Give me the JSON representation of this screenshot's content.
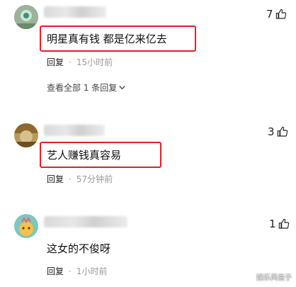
{
  "comments": [
    {
      "likes": "7",
      "text": "明星真有钱 都是亿来亿去",
      "reply_label": "回复",
      "time": "15小时前",
      "expand_label": "查看全部 1 条回复"
    },
    {
      "likes": "3",
      "text": "艺人赚钱真容易",
      "reply_label": "回复",
      "time": "57分钟前"
    },
    {
      "likes": "1",
      "text": "这女的不俊呀",
      "reply_label": "回复",
      "time": "1小时前"
    }
  ],
  "watermark": "娱乐风信子",
  "colors": {
    "highlight_box": "#e0202a",
    "meta_text": "#999999"
  }
}
